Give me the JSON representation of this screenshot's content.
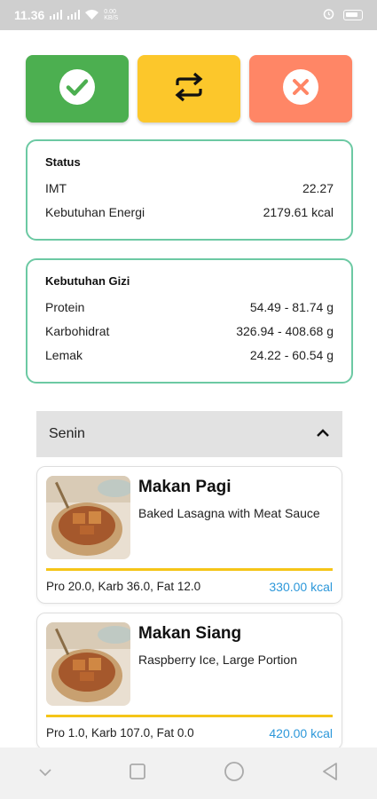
{
  "status_bar": {
    "time": "11.36",
    "network_speed_line1": "0.00",
    "network_speed_line2": "KB/S"
  },
  "summary_card": {
    "title": "Status",
    "rows": [
      {
        "label": "IMT",
        "value": "22.27"
      },
      {
        "label": "Kebutuhan Energi",
        "value": "2179.61 kcal"
      }
    ]
  },
  "nutrition_card": {
    "title": "Kebutuhan Gizi",
    "rows": [
      {
        "label": "Protein",
        "value": "54.49 - 81.74 g"
      },
      {
        "label": "Karbohidrat",
        "value": "326.94 - 408.68 g"
      },
      {
        "label": "Lemak",
        "value": "24.22 - 60.54 g"
      }
    ]
  },
  "day_section": {
    "label": "Senin",
    "expanded": true
  },
  "meals": [
    {
      "title": "Makan Pagi",
      "description": "Baked Lasagna with Meat Sauce",
      "macros": "Pro 20.0, Karb 36.0, Fat 12.0",
      "kcal": "330.00 kcal"
    },
    {
      "title": "Makan Siang",
      "description": "Raspberry Ice, Large Portion",
      "macros": "Pro 1.0, Karb 107.0, Fat 0.0",
      "kcal": "420.00 kcal"
    }
  ],
  "colors": {
    "accept": "#4caf50",
    "regenerate": "#fcc72b",
    "reject": "#ff8666",
    "card_border": "#6cc9a3",
    "kcal_text": "#2d98da",
    "divider": "#f5c518"
  },
  "icons": {
    "accept": "check-circle-icon",
    "regenerate": "repeat-icon",
    "reject": "close-circle-icon",
    "collapse": "chevron-up-icon"
  }
}
